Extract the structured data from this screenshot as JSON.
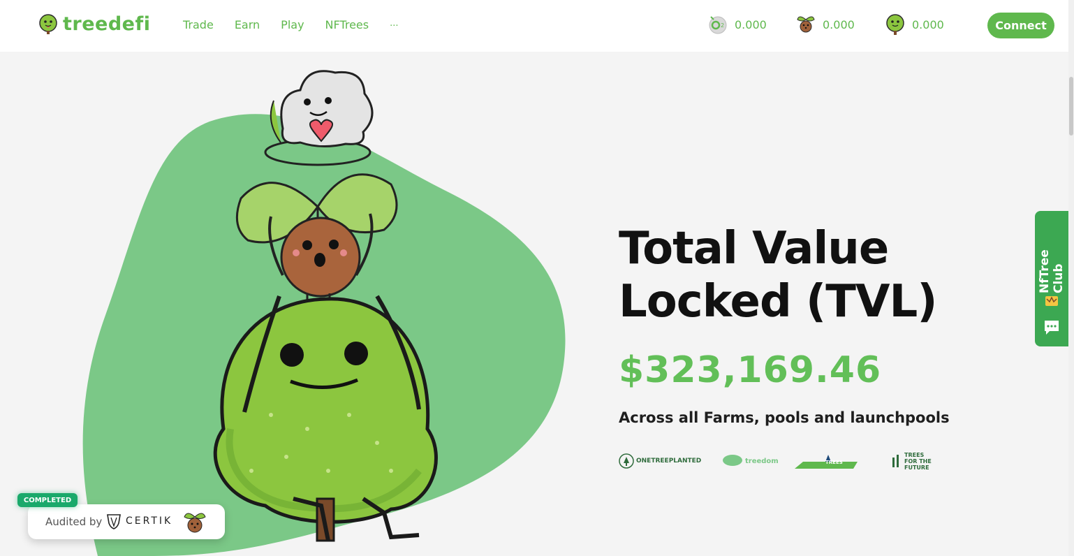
{
  "header": {
    "brand": "treedefi",
    "nav": [
      {
        "label": "Trade"
      },
      {
        "label": "Earn"
      },
      {
        "label": "Play"
      },
      {
        "label": "NFTrees"
      },
      {
        "label": "..."
      }
    ],
    "tokens": [
      {
        "icon": "co2-token-icon",
        "value": "0.000"
      },
      {
        "icon": "seed-token-icon",
        "value": "0.000"
      },
      {
        "icon": "tree-token-icon",
        "value": "0.000"
      }
    ],
    "connect_label": "Connect"
  },
  "hero": {
    "title": "Total Value\nLocked (TVL)",
    "value": "$323,169.46",
    "subtitle": "Across all Farms, pools and launchpools",
    "partners": [
      {
        "name": "ONETREEPLANTED"
      },
      {
        "name": "treedom"
      },
      {
        "name": "TREES"
      },
      {
        "name": "TREES FOR THE FUTURE"
      }
    ]
  },
  "club_tab": {
    "label": "NfTree Club"
  },
  "audit": {
    "badge": "COMPLETED",
    "label": "Audited by",
    "auditor": "CERTIK"
  },
  "colors": {
    "brand_green": "#5fb84d",
    "value_green": "#62bf58",
    "blob_green": "#7bc887",
    "club_green": "#3ca852",
    "badge_green": "#1aa96b"
  }
}
